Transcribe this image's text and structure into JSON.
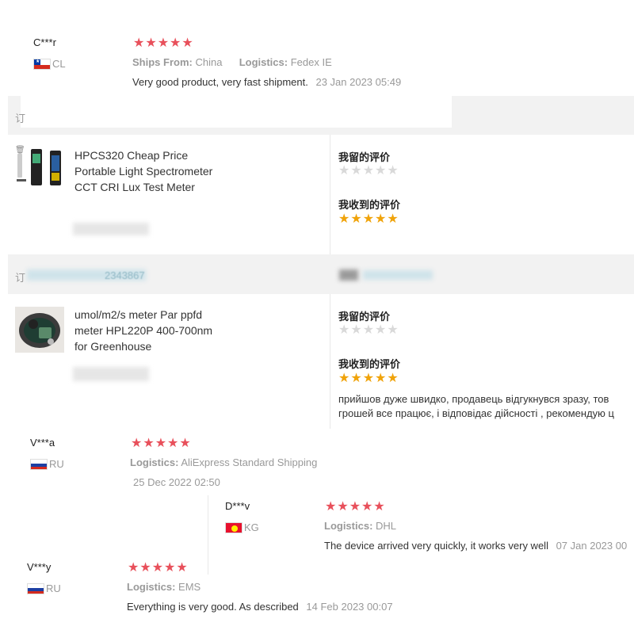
{
  "review_top": {
    "user": "C***r",
    "country": "CL",
    "rating": 5,
    "ships_from_label": "Ships From:",
    "ships_from_value": "China",
    "logistics_label": "Logistics:",
    "logistics_value": "Fedex IE",
    "text": "Very good product, very fast shipment.",
    "date": "23 Jan 2023 05:49"
  },
  "order1": {
    "band_char": "订",
    "product_title": "HPCS320 Cheap Price Portable Light Spectrometer CCT CRI Lux Test Meter",
    "my_review_label": "我留的评价",
    "my_review_rating": 0,
    "received_review_label": "我收到的评价",
    "received_review_rating": 5
  },
  "order2": {
    "band_char": "订",
    "band_order_fragment": "2343867",
    "product_title": "umol/m2/s meter Par ppfd meter HPL220P 400-700nm for Greenhouse",
    "my_review_label": "我留的评价",
    "my_review_rating": 0,
    "received_review_label": "我收到的评价",
    "received_review_rating": 5,
    "received_review_text_line1": "прийшов дуже швидко, продавець відгукнувся зразу, тов",
    "received_review_text_line2": "грошей все працює, і відповідає дійсності , рекомендую ц"
  },
  "review_v1": {
    "user": "V***a",
    "country": "RU",
    "rating": 5,
    "logistics_label": "Logistics:",
    "logistics_value": "AliExpress Standard Shipping",
    "date": "25 Dec 2022 02:50"
  },
  "review_d": {
    "user": "D***v",
    "country": "KG",
    "rating": 5,
    "logistics_label": "Logistics:",
    "logistics_value": "DHL",
    "text": "The device arrived very quickly, it works very well",
    "date": "07 Jan 2023 00"
  },
  "review_v2": {
    "user": "V***y",
    "country": "RU",
    "rating": 5,
    "logistics_label": "Logistics:",
    "logistics_value": "EMS",
    "text": "Everything is very good. As described",
    "date": "14 Feb 2023 00:07"
  },
  "colors": {
    "star_red": "#e8505b",
    "star_gold": "#f0a30a",
    "star_empty": "#d9d9d9",
    "band_grey": "#f2f2f2"
  },
  "icons": [
    "star-icon",
    "flag-cl-icon",
    "flag-ru-icon",
    "flag-kg-icon",
    "trash-icon"
  ]
}
